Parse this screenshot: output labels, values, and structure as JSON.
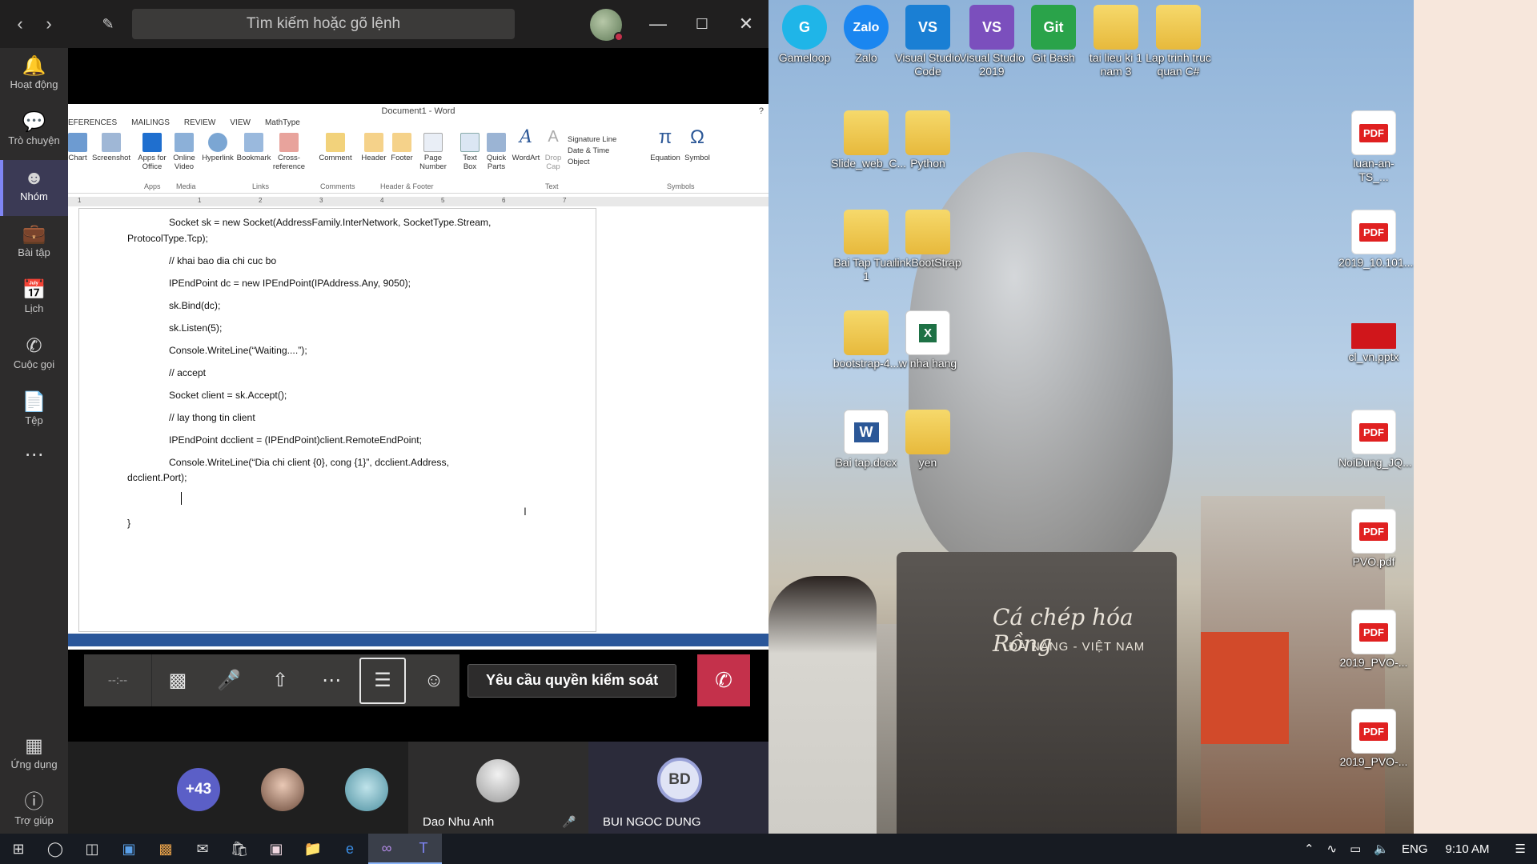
{
  "teams": {
    "search_placeholder": "Tìm kiếm hoặc gõ lệnh",
    "rail": [
      {
        "label": "Hoạt động",
        "icon": "bell-icon"
      },
      {
        "label": "Trò chuyện",
        "icon": "chat-icon"
      },
      {
        "label": "Nhóm",
        "icon": "teams-icon"
      },
      {
        "label": "Bài tập",
        "icon": "backpack-icon"
      },
      {
        "label": "Lịch",
        "icon": "calendar-icon"
      },
      {
        "label": "Cuộc gọi",
        "icon": "phone-icon"
      },
      {
        "label": "Tệp",
        "icon": "file-icon"
      },
      {
        "label": "Ứng dụng",
        "icon": "apps-icon"
      },
      {
        "label": "Trợ giúp",
        "icon": "help-icon"
      }
    ],
    "active_rail": "Nhóm"
  },
  "word": {
    "title": "Document1 - Word",
    "help": "?",
    "tabs": [
      "EFERENCES",
      "MAILINGS",
      "REVIEW",
      "VIEW",
      "MathType"
    ],
    "ribbon": [
      {
        "label": "Chart",
        "sub": ""
      },
      {
        "label": "Screenshot",
        "sub": ""
      },
      {
        "label": "Apps for",
        "sub": "Office"
      },
      {
        "label": "Online",
        "sub": "Video"
      },
      {
        "label": "Hyperlink",
        "sub": ""
      },
      {
        "label": "Bookmark",
        "sub": ""
      },
      {
        "label": "Cross-",
        "sub": "reference"
      },
      {
        "label": "Comment",
        "sub": ""
      },
      {
        "label": "Header",
        "sub": ""
      },
      {
        "label": "Footer",
        "sub": ""
      },
      {
        "label": "Page",
        "sub": "Number"
      },
      {
        "label": "Text",
        "sub": "Box"
      },
      {
        "label": "Quick",
        "sub": "Parts"
      },
      {
        "label": "WordArt",
        "sub": ""
      },
      {
        "label": "Drop",
        "sub": "Cap"
      },
      {
        "label": "Equation",
        "sub": ""
      },
      {
        "label": "Symbol",
        "sub": ""
      }
    ],
    "text_small": [
      "Signature Line",
      "Date & Time",
      "Object"
    ],
    "groups": [
      "Apps",
      "Media",
      "Links",
      "Comments",
      "Header & Footer",
      "Text",
      "Symbols"
    ],
    "ruler": [
      "1",
      "1",
      "2",
      "3",
      "4",
      "5",
      "6",
      "7"
    ],
    "code_lines": [
      "Socket sk = new Socket(AddressFamily.InterNetwork, SocketType.Stream,",
      "ProtocolType.Tcp);",
      "// khai bao dia chi cuc bo",
      "IPEndPoint dc = new IPEndPoint(IPAddress.Any, 9050);",
      "sk.Bind(dc);",
      "sk.Listen(5);",
      "Console.WriteLine(“Waiting....”);",
      "// accept",
      "Socket client = sk.Accept();",
      "// lay thong tin client",
      "IPEndPoint dcclient = (IPEndPoint)client.RemoteEndPoint;",
      "Console.WriteLine(“Dia chi client {0}, cong {1}”, dcclient.Address,",
      "dcclient.Port);",
      "}"
    ]
  },
  "meeting": {
    "timer": "--:--",
    "request_control": "Yêu cầu quyền kiểm soát",
    "extra_participants": "+43",
    "participants": [
      {
        "name": "Dao Nhu Anh"
      },
      {
        "name": "BUI NGOC DUNG",
        "initials": "BD"
      }
    ]
  },
  "desktop": {
    "icons": [
      {
        "label": "Gameloop",
        "type": "app",
        "glyph": "G",
        "color": "#1fb5e8"
      },
      {
        "label": "Zalo",
        "type": "app",
        "glyph": "Zalo",
        "color": "#1a86f0"
      },
      {
        "label": "Visual Studio Code",
        "type": "app",
        "glyph": "VS",
        "color": "#1a7fd4"
      },
      {
        "label": "Visual Studio 2019",
        "type": "app",
        "glyph": "VS",
        "color": "#7b4fbd"
      },
      {
        "label": "Git Bash",
        "type": "app",
        "glyph": "Git",
        "color": "#2aa34a"
      },
      {
        "label": "tai lieu ki 1 nam 3",
        "type": "folder"
      },
      {
        "label": "Lap trinh truc quan C#",
        "type": "folder"
      },
      {
        "label": "Slide_web_C...",
        "type": "folder"
      },
      {
        "label": "Python",
        "type": "folder"
      },
      {
        "label": "Bai Tap Tuan 1",
        "type": "folder"
      },
      {
        "label": "linkBootStrap",
        "type": "folder"
      },
      {
        "label": "bootstrap-4...",
        "type": "folder"
      },
      {
        "label": "w nha hang",
        "type": "excel"
      },
      {
        "label": "Bai tap.docx",
        "type": "word"
      },
      {
        "label": "yen",
        "type": "folder"
      },
      {
        "label": "luan-an-TS_...",
        "type": "pdf"
      },
      {
        "label": "2019_10.101...",
        "type": "pdf"
      },
      {
        "label": "cl_vn.pptx",
        "type": "pptx"
      },
      {
        "label": "NoiDung_JQ...",
        "type": "pdf"
      },
      {
        "label": "PVO.pdf",
        "type": "pdf"
      },
      {
        "label": "2019_PVO-...",
        "type": "pdf"
      },
      {
        "label": "2019_PVO-...",
        "type": "pdf"
      }
    ],
    "wallpaper_text1": "Cá chép hóa Rồng",
    "wallpaper_text2": "ĐÀ NẴNG - VIỆT NAM"
  },
  "taskbar": {
    "lang": "ENG",
    "time": "9:10 AM"
  },
  "colors": {
    "teams_accent": "#7f85f5",
    "hangup": "#c4314b",
    "word_blue": "#2b579a"
  }
}
